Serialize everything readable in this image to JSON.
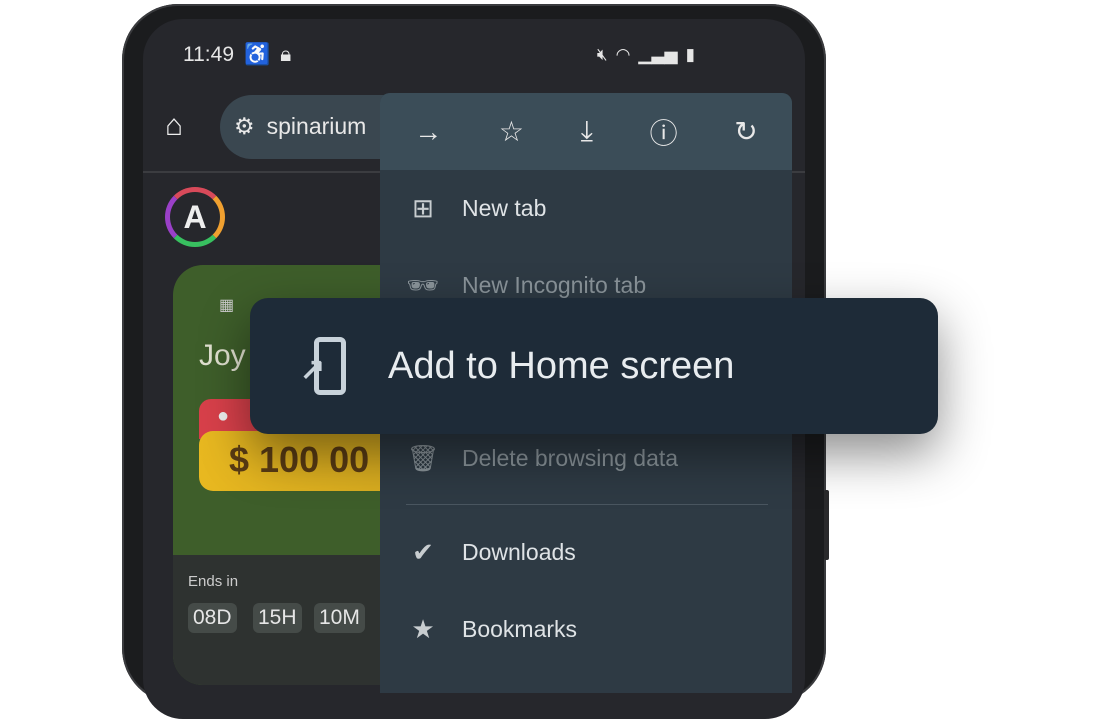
{
  "status_bar": {
    "time": "11:49",
    "left_icons": [
      "accessibility-icon",
      "lock-icon"
    ],
    "right_icons": [
      "mute-icon",
      "wifi-icon",
      "signal-icon",
      "battery-icon"
    ]
  },
  "toolbar": {
    "url": "spinarium",
    "home_icon": "home-icon",
    "site_settings_icon": "tune-icon"
  },
  "menu": {
    "top_icons": [
      "forward-icon",
      "star-icon",
      "download-icon",
      "info-icon",
      "refresh-icon"
    ],
    "items": [
      {
        "label": "New tab",
        "icon": "new-tab-icon"
      },
      {
        "label": "New Incognito tab",
        "icon": "incognito-icon"
      },
      {
        "label": "Delete browsing data",
        "icon": "trash-icon"
      },
      {
        "label": "Downloads",
        "icon": "downloads-icon"
      },
      {
        "label": "Bookmarks",
        "icon": "bookmark-star-icon"
      }
    ]
  },
  "popup": {
    "label": "Add to Home screen",
    "icon": "add-to-home-screen-icon"
  },
  "page": {
    "title_partial": "Joy",
    "amount_partial": "$ 100 00",
    "ends_label": "Ends in",
    "countdown": [
      "08D",
      "15H",
      "10M"
    ]
  },
  "colors": {
    "menu_bg": "#2e3a44",
    "menu_top": "#3b4d58",
    "popup_bg": "#1e2b38",
    "card_green": "#3e5e2a",
    "prize_yellow": "#e8b820",
    "badge_red": "#d8404a"
  }
}
